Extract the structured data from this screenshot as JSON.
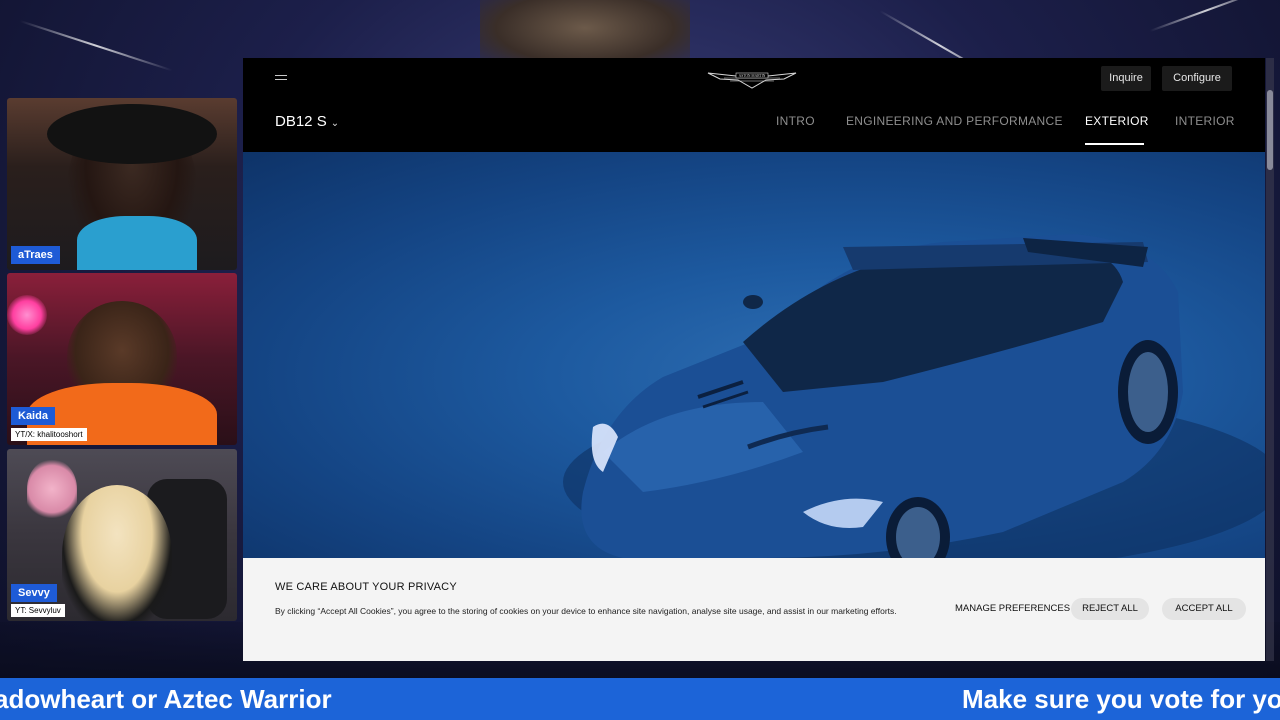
{
  "stream": {
    "cams": [
      {
        "name": "aTraes",
        "subtitle": ""
      },
      {
        "name": "Kaida",
        "subtitle": "YT/X: khalitooshort"
      },
      {
        "name": "Sevvy",
        "subtitle": "YT: Sevvyluv"
      }
    ],
    "ticker": {
      "left_text": "adowheart or Aztec Warrior",
      "right_text": "Make sure you vote for you"
    },
    "colors": {
      "ticker": "#1c64d8",
      "cam_label": "#1e5bd6"
    }
  },
  "site": {
    "brand": "ASTON MARTIN",
    "header": {
      "menu_icon": "hamburger-icon",
      "inquire_label": "Inquire",
      "configure_label": "Configure",
      "model": "DB12 S",
      "model_chevron": "chevron-down-icon"
    },
    "tabs": [
      {
        "label": "INTRO",
        "active": false
      },
      {
        "label": "ENGINEERING AND PERFORMANCE",
        "active": false
      },
      {
        "label": "EXTERIOR",
        "active": true
      },
      {
        "label": "INTERIOR",
        "active": false
      }
    ],
    "cookie": {
      "title": "WE CARE ABOUT YOUR PRIVACY",
      "text": "By clicking “Accept All Cookies”, you agree to the storing of cookies on your device to enhance site navigation, analyse site usage, and assist in our marketing efforts.",
      "manage_label": "MANAGE PREFERENCES",
      "reject_label": "REJECT ALL",
      "accept_label": "ACCEPT ALL"
    }
  }
}
